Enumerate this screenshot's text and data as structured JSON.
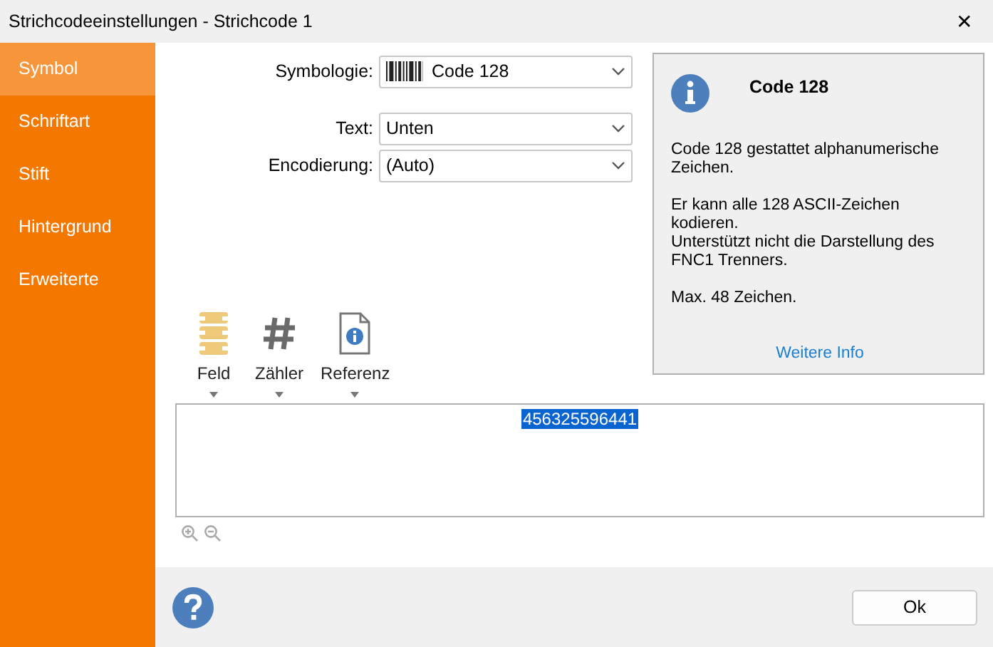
{
  "window": {
    "title": "Strichcodeeinstellungen - Strichcode 1",
    "close": "✕"
  },
  "sidebar": {
    "items": [
      {
        "label": "Symbol",
        "selected": true
      },
      {
        "label": "Schriftart",
        "selected": false
      },
      {
        "label": "Stift",
        "selected": false
      },
      {
        "label": "Hintergrund",
        "selected": false
      },
      {
        "label": "Erweiterte",
        "selected": false
      }
    ]
  },
  "form": [
    {
      "label": "Symbologie:",
      "value": "Code 128",
      "kind": "barcode"
    },
    {
      "label": "Text:",
      "value": "Unten",
      "kind": "plain"
    },
    {
      "label": "Encodierung:",
      "value": "(Auto)",
      "kind": "plain"
    }
  ],
  "info": {
    "title": "Code 128",
    "paragraphs": [
      [
        "Code 128 gestattet alphanumerische Zeichen."
      ],
      [
        "Er kann alle 128 ASCII-Zeichen kodieren.",
        "Unterstützt nicht die Darstellung des FNC1 Trenners."
      ],
      [
        "Max. 48 Zeichen."
      ]
    ],
    "link": "Weitere Info"
  },
  "toolbar": [
    {
      "label": "Feld",
      "kind": "field"
    },
    {
      "label": "Zähler",
      "kind": "counter"
    },
    {
      "label": "Referenz",
      "kind": "reference"
    }
  ],
  "editor": {
    "value": "456325596441",
    "selected": true
  },
  "buttons": [
    "Ok"
  ]
}
